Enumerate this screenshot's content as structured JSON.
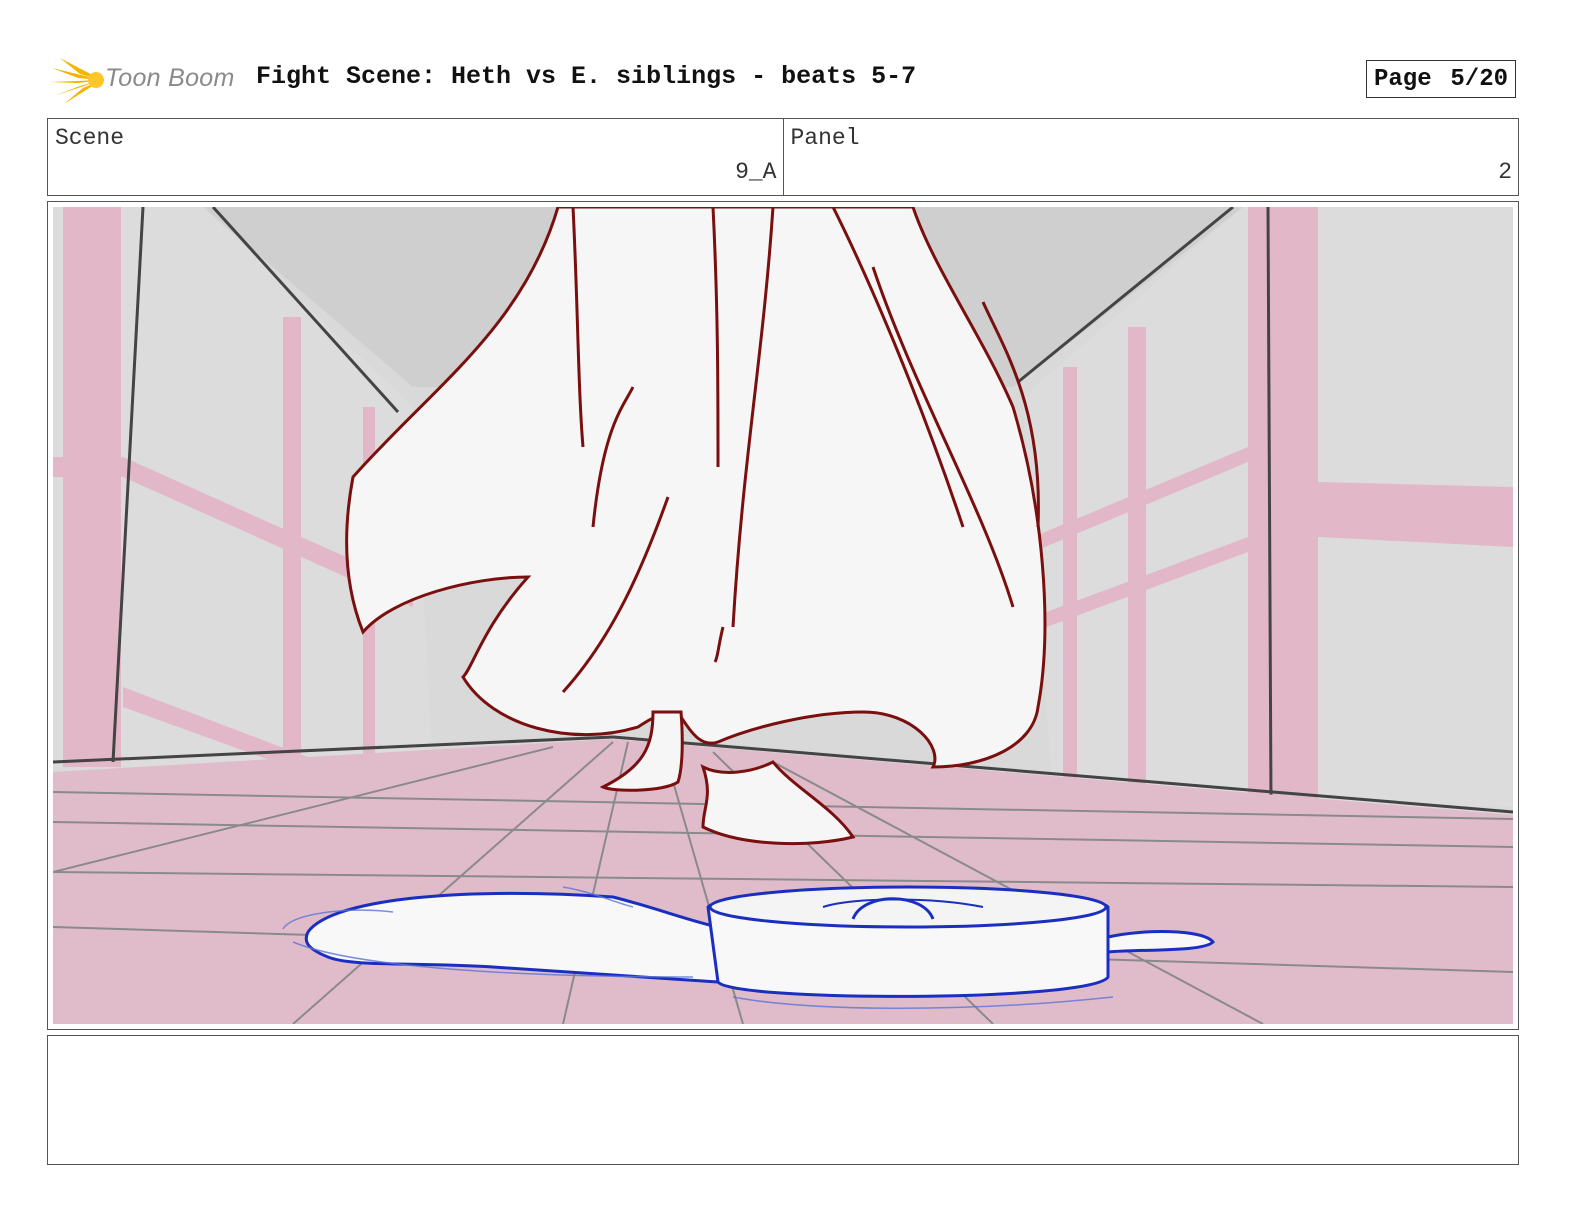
{
  "header": {
    "logo_text": "Toon Boom",
    "title": "Fight Scene: Heth vs E. siblings - beats 5-7",
    "page_label": "Page",
    "page_value": "5/20"
  },
  "info": {
    "scene_label": "Scene",
    "scene_value": "9_A",
    "panel_label": "Panel",
    "panel_value": "2"
  },
  "notes": {
    "text": ""
  },
  "colors": {
    "sketch_red": "#7a0f0f",
    "sketch_blue": "#1a2fbf",
    "set_pink": "#e2b8c8",
    "wall_gray": "#d6d6d6"
  },
  "icons": [
    "toon-boom-logo-icon"
  ]
}
